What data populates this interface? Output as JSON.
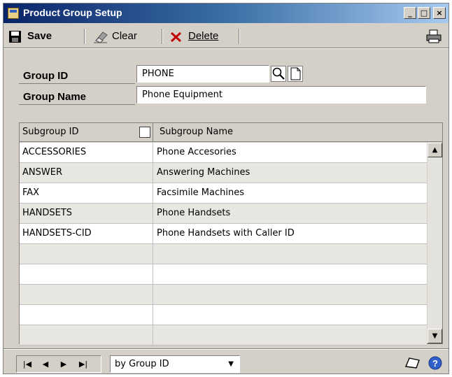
{
  "window": {
    "title": "Product Group Setup",
    "minimize": "_",
    "maximize": "□",
    "close": "×"
  },
  "toolbar": {
    "save_label": "Save",
    "clear_label": "Clear",
    "delete_label": "Delete"
  },
  "form": {
    "group_id_label": "Group ID",
    "group_id_value": "PHONE",
    "group_name_label": "Group Name",
    "group_name_value": "Phone Equipment"
  },
  "grid": {
    "columns": [
      "Subgroup ID",
      "Subgroup Name"
    ],
    "rows": [
      [
        "ACCESSORIES",
        "Phone Accesories"
      ],
      [
        "ANSWER",
        "Answering Machines"
      ],
      [
        "FAX",
        "Facsimile Machines"
      ],
      [
        "HANDSETS",
        "Phone Handsets"
      ],
      [
        "HANDSETS-CID",
        "Phone Handsets with Caller ID"
      ],
      [
        "",
        ""
      ],
      [
        "",
        ""
      ],
      [
        "",
        ""
      ],
      [
        "",
        ""
      ],
      [
        "",
        ""
      ]
    ]
  },
  "bottom": {
    "sort_by": "by Group ID"
  },
  "icons": {
    "lookup": "lookup-icon",
    "note": "note-icon",
    "print": "printer-icon",
    "help": "help-icon"
  }
}
